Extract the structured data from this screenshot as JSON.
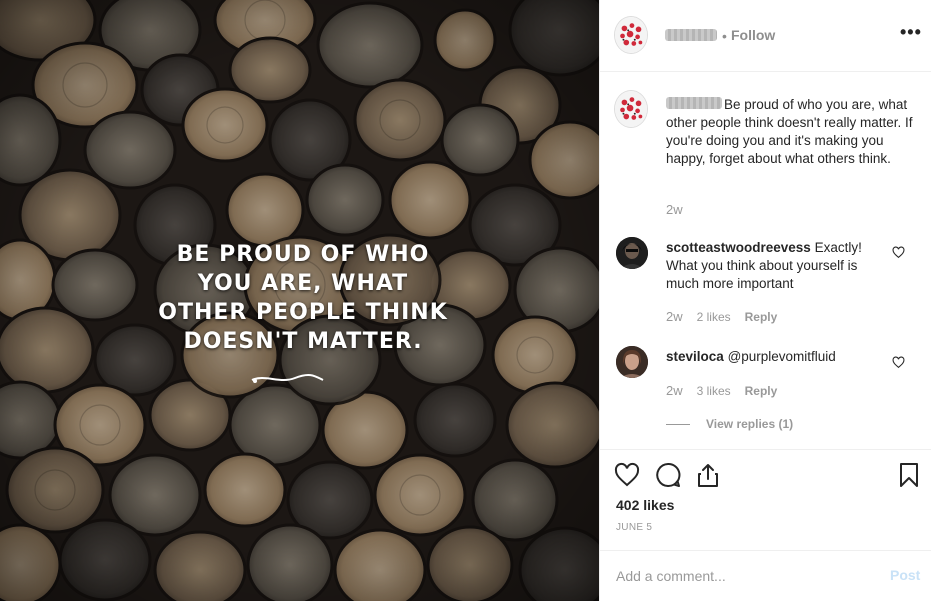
{
  "image": {
    "quote_lines": [
      "BE PROUD OF WHO",
      "YOU ARE, WHAT",
      "OTHER PEOPLE THINK",
      "DOESN'T MATTER."
    ]
  },
  "header": {
    "separator": "•",
    "follow_label": "Follow",
    "more_label": "•••"
  },
  "caption": {
    "text": "Be proud of who you are, what other people think doesn't really matter. If you're doing you and it's making you happy, forget about what others think.",
    "time": "2w"
  },
  "comments": [
    {
      "username": "scotteastwoodreevess",
      "text": "Exactly! What you think about yourself is much more important",
      "time": "2w",
      "likes": "2 likes",
      "reply_label": "Reply"
    },
    {
      "username": "steviloca",
      "text": "@purplevomitfluid",
      "time": "2w",
      "likes": "3 likes",
      "reply_label": "Reply"
    }
  ],
  "view_replies_label": "View replies (1)",
  "actions": {
    "icons": [
      "heart-icon",
      "comment-icon",
      "share-icon",
      "bookmark-icon"
    ]
  },
  "likes_count": "402 likes",
  "post_date": "JUNE 5",
  "add_comment": {
    "placeholder": "Add a comment...",
    "post_label": "Post"
  },
  "colors": {
    "link_muted": "#999999",
    "post_disabled": "#c9e2f7",
    "text": "#262626"
  }
}
